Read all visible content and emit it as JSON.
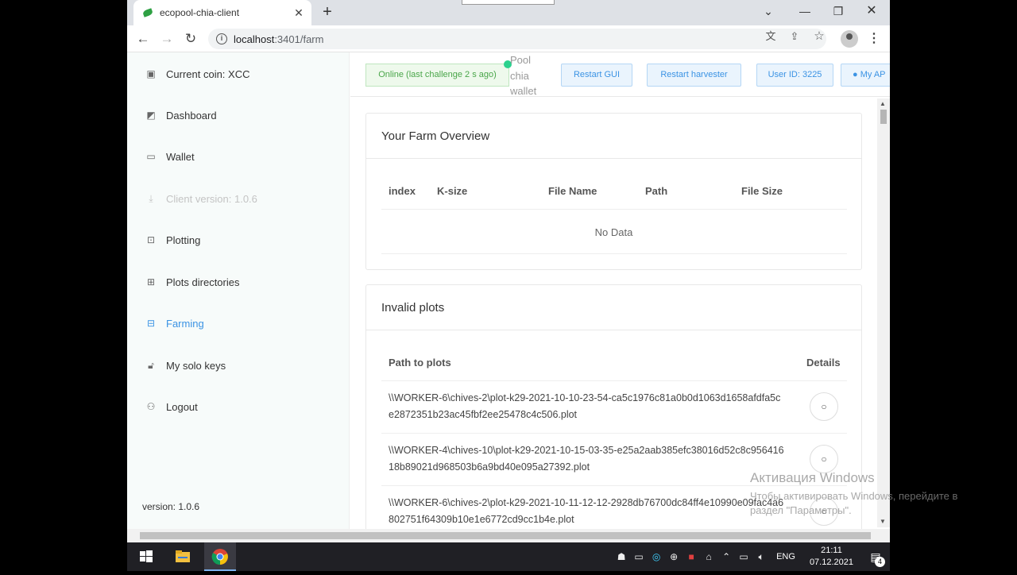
{
  "browser": {
    "tab_title": "ecopool-chia-client",
    "url_host": "localhost",
    "url_rest": ":3401/farm"
  },
  "sidebar": {
    "items": [
      {
        "label": "Current coin: XCC",
        "icon": "monitor-icon"
      },
      {
        "label": "Dashboard",
        "icon": "chart-icon"
      },
      {
        "label": "Wallet",
        "icon": "wallet-icon"
      },
      {
        "label": "Client version: 1.0.6",
        "icon": "download-icon"
      },
      {
        "label": "Plotting",
        "icon": "inbox-icon"
      },
      {
        "label": "Plots directories",
        "icon": "folder-add-icon"
      },
      {
        "label": "Farming",
        "icon": "gift-icon"
      },
      {
        "label": "My solo keys",
        "icon": "lock-icon"
      },
      {
        "label": "Logout",
        "icon": "user-icon"
      }
    ],
    "version": "version: 1.0.6"
  },
  "header": {
    "status": "Online (last challenge 2 s ago)",
    "pool_label": "Pool chia wallet",
    "restart_gui": "Restart GUI",
    "restart_harvester": "Restart harvester",
    "user_id": "User ID: 3225",
    "my_api": "My AP"
  },
  "farm_overview": {
    "title": "Your Farm Overview",
    "columns": [
      "index",
      "K-size",
      "File Name",
      "Path",
      "File Size"
    ],
    "empty_text": "No Data"
  },
  "invalid_plots": {
    "title": "Invalid plots",
    "columns": [
      "Path to plots",
      "Details"
    ],
    "rows": [
      "\\\\WORKER-6\\chives-2\\plot-k29-2021-10-10-23-54-ca5c1976c81a0b0d1063d1658afdfa5ce2872351b23ac45fbf2ee25478c4c506.plot",
      "\\\\WORKER-4\\chives-10\\plot-k29-2021-10-15-03-35-e25a2aab385efc38016d52c8c95641618b89021d968503b6a9bd40e095a27392.plot",
      "\\\\WORKER-6\\chives-2\\plot-k29-2021-10-11-12-12-2928db76700dc84ff4e10990e09fac4a6802751f64309b10e1e6772cd9cc1b4e.plot"
    ]
  },
  "watermark": {
    "line1": "Активация Windows",
    "line2": "Чтобы активировать Windows, перейдите в раздел \"Параметры\"."
  },
  "taskbar": {
    "lang": "ENG",
    "time": "21:11",
    "date": "07.12.2021",
    "notif_count": "4"
  },
  "colors": {
    "accent": "#3b93e4",
    "online_green": "#4aa64a",
    "dot_green": "#2bd18d"
  }
}
